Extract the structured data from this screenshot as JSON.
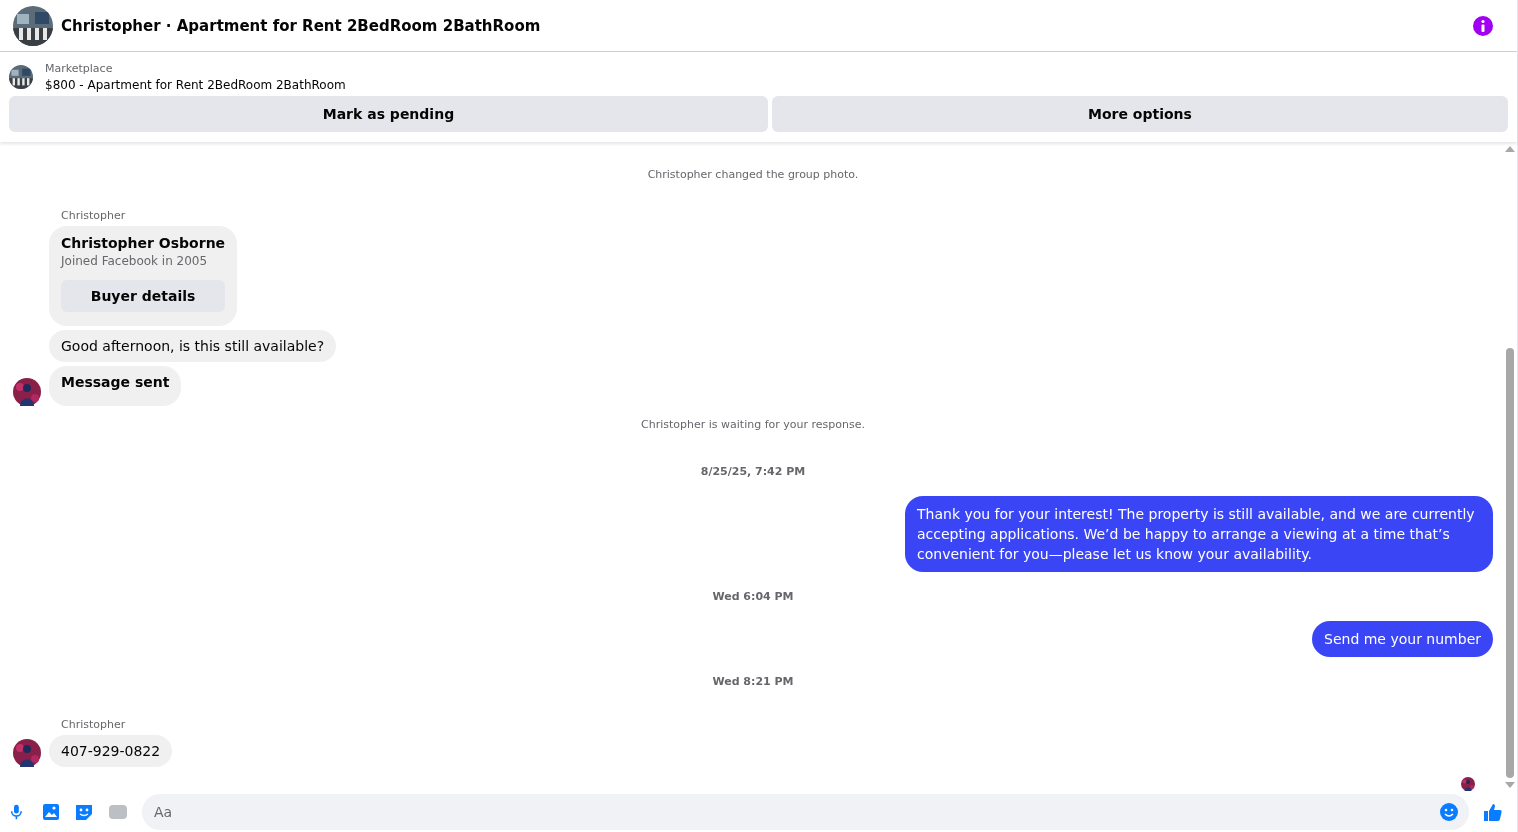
{
  "header": {
    "title": "Christopher · Apartment for Rent 2BedRoom 2BathRoom"
  },
  "listing": {
    "source": "Marketplace",
    "title": "$800 - Apartment for Rent 2BedRoom 2BathRoom",
    "buttons": [
      "Mark as pending",
      "More options"
    ]
  },
  "messages": [
    {
      "kind": "system",
      "text": "Christopher changed the group photo."
    },
    {
      "kind": "sender",
      "text": "Christopher"
    },
    {
      "kind": "profile_card",
      "name": "Christopher Osborne",
      "detail": "Joined Facebook in 2005",
      "button": "Buyer details"
    },
    {
      "kind": "incoming",
      "text": "Good afternoon, is this still available?",
      "emphasis": false,
      "avatar": false
    },
    {
      "kind": "incoming",
      "text": "Message sent",
      "emphasis": true,
      "avatar": true
    },
    {
      "kind": "system",
      "text": "Christopher is waiting for your response."
    },
    {
      "kind": "timestamp",
      "text": "8/25/25, 7:42 PM"
    },
    {
      "kind": "outgoing",
      "text": "Thank you for your interest! The property is still available, and we are currently accepting applications. We’d be happy to arrange a viewing at a time that’s convenient for you—please let us know your availability."
    },
    {
      "kind": "timestamp",
      "text": "Wed 6:04 PM"
    },
    {
      "kind": "outgoing",
      "text": "Send me your number"
    },
    {
      "kind": "timestamp",
      "text": "Wed 8:21 PM"
    },
    {
      "kind": "sender",
      "text": "Christopher"
    },
    {
      "kind": "incoming",
      "text": "407-929-0822",
      "emphasis": false,
      "avatar": true
    }
  ],
  "composer": {
    "placeholder": "Aa"
  }
}
